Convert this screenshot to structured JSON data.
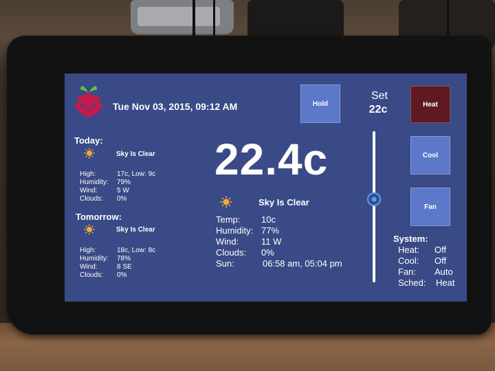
{
  "header": {
    "datetime": "Tue Nov 03, 2015, 09:12 AM"
  },
  "controls": {
    "hold_label": "Hold",
    "set_label": "Set",
    "set_value": "22c",
    "heat_label": "Heat",
    "cool_label": "Cool",
    "fan_label": "Fan",
    "active_mode_color": "#5e1a20",
    "button_color": "#5b78c9"
  },
  "current": {
    "temperature": "22.4c",
    "condition": "Sky Is Clear",
    "icon": "sun-icon",
    "temp_label": "Temp:",
    "temp_value": "10c",
    "humidity_label": "Humidity:",
    "humidity_value": "77%",
    "wind_label": "Wind:",
    "wind_value": "11 W",
    "clouds_label": "Clouds:",
    "clouds_value": "0%",
    "sun_label": "Sun:",
    "sun_value": "06:58 am, 05:04 pm"
  },
  "today": {
    "title": "Today:",
    "condition": "Sky Is Clear",
    "high_label": "High:",
    "high_value": "17c, Low: 9c",
    "humidity_label": "Humidity:",
    "humidity_value": "79%",
    "wind_label": "Wind:",
    "wind_value": "5 W",
    "clouds_label": "Clouds:",
    "clouds_value": "0%"
  },
  "tomorrow": {
    "title": "Tomorrow:",
    "condition": "Sky Is Clear",
    "high_label": "High:",
    "high_value": "18c, Low: 8c",
    "humidity_label": "Humidity:",
    "humidity_value": "78%",
    "wind_label": "Wind:",
    "wind_value": "8 SE",
    "clouds_label": "Clouds:",
    "clouds_value": "0%"
  },
  "system": {
    "title": "System:",
    "heat_label": "Heat:",
    "heat_value": "Off",
    "cool_label": "Cool:",
    "cool_value": "Off",
    "fan_label": "Fan:",
    "fan_value": "Auto",
    "sched_label": "Sched:",
    "sched_value": "Heat"
  },
  "slider": {
    "level": 0.45
  }
}
